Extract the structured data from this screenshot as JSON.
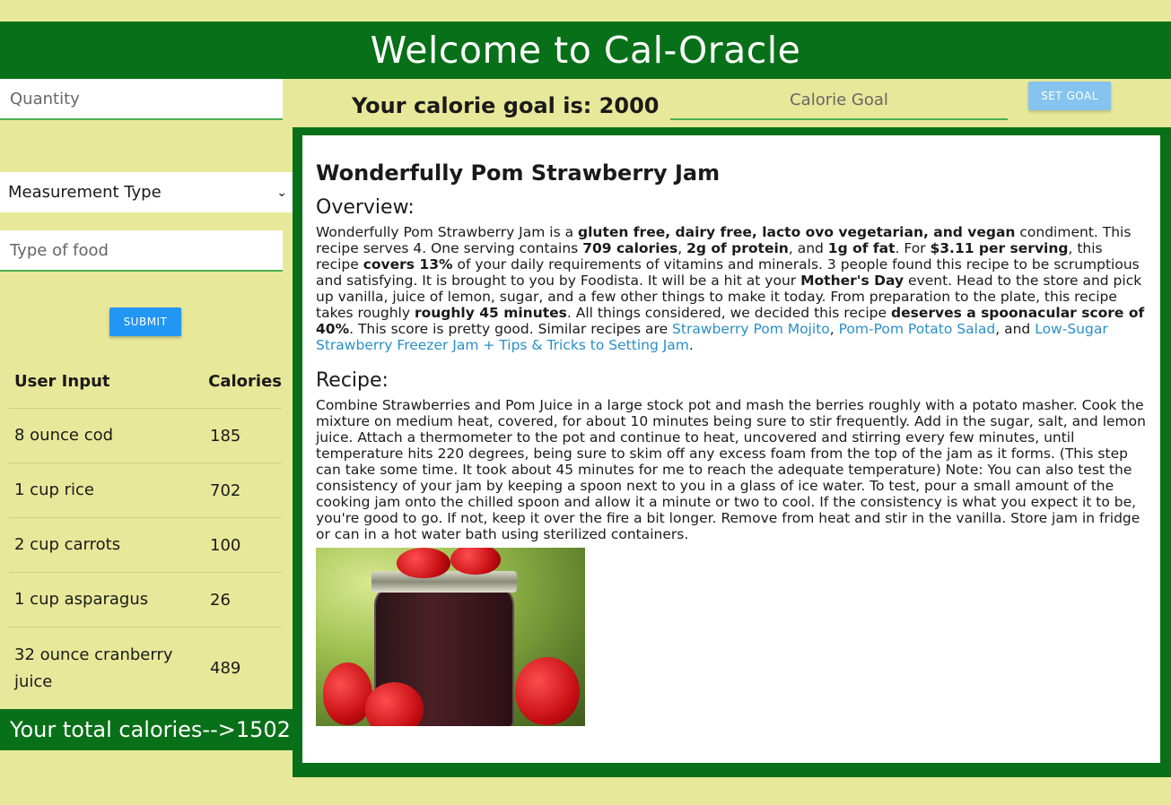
{
  "header": {
    "title": "Welcome to Cal-Oracle"
  },
  "form": {
    "quantity_placeholder": "Quantity",
    "measurement_selected": "Measurement Type",
    "food_placeholder": "Type of food",
    "submit_label": "SUBMIT"
  },
  "table": {
    "headers": [
      "User Input",
      "Calories"
    ],
    "rows": [
      {
        "input": "8 ounce cod",
        "calories": "185"
      },
      {
        "input": "1 cup rice",
        "calories": "702"
      },
      {
        "input": "2 cup carrots",
        "calories": "100"
      },
      {
        "input": "1 cup asparagus",
        "calories": "26"
      },
      {
        "input": "32 ounce cranberry juice",
        "calories": "489"
      }
    ]
  },
  "total": {
    "text": "Your total calories-->1502"
  },
  "goal": {
    "text": "Your calorie goal is: 2000",
    "input_placeholder": "Calorie Goal",
    "button_label": "SET GOAL"
  },
  "recipe": {
    "title": "Wonderfully Pom Strawberry Jam",
    "overview_heading": "Overview:",
    "overview": {
      "t1": "Wonderfully Pom Strawberry Jam is a ",
      "b1": "gluten free, dairy free, lacto ovo vegetarian, and vegan",
      "t2": " condiment. This recipe serves 4. One serving contains ",
      "b2": "709 calories",
      "t3": ", ",
      "b3": "2g of protein",
      "t4": ", and ",
      "b4": "1g of fat",
      "t5": ". For ",
      "b5": "$3.11 per serving",
      "t6": ", this recipe ",
      "b6": "covers 13%",
      "t7": " of your daily requirements of vitamins and minerals. 3 people found this recipe to be scrumptious and satisfying. It is brought to you by Foodista. It will be a hit at your ",
      "b7": "Mother's Day",
      "t8": " event. Head to the store and pick up vanilla, juice of lemon, sugar, and a few other things to make it today. From preparation to the plate, this recipe takes roughly ",
      "b8": "roughly 45 minutes",
      "t9": ". All things considered, we decided this recipe ",
      "b9": "deserves a spoonacular score of 40%",
      "t10": ". This score is pretty good. Similar recipes are ",
      "link1": "Strawberry Pom Mojito",
      "t11": ", ",
      "link2": "Pom-Pom Potato Salad",
      "t12": ", and ",
      "link3": "Low-Sugar Strawberry Freezer Jam + Tips & Tricks to Setting Jam",
      "t13": "."
    },
    "recipe_heading": "Recipe:",
    "instructions": "Combine Strawberries and Pom Juice in a large stock pot and mash the berries roughly with a potato masher. Cook the mixture on medium heat, covered, for about 10 minutes being sure to stir frequently. Add in the sugar, salt, and lemon juice. Attach a thermometer to the pot and continue to heat, uncovered and stirring every few minutes, until temperature hits 220 degrees, being sure to skim off any excess foam from the top of the jam as it forms. (This step can take some time. It took about 45 minutes for me to reach the adequate temperature) Note: You can also test the consistency of your jam by keeping a spoon next to you in a glass of ice water. To test, pour a small amount of the cooking jam onto the chilled spoon and allow it a minute or two to cool. If the consistency is what you expect it to be, you're good to go. If not, keep it over the fire a bit longer. Remove from heat and stir in the vanilla. Store jam in fridge or can in a hot water bath using sterilized containers."
  }
}
